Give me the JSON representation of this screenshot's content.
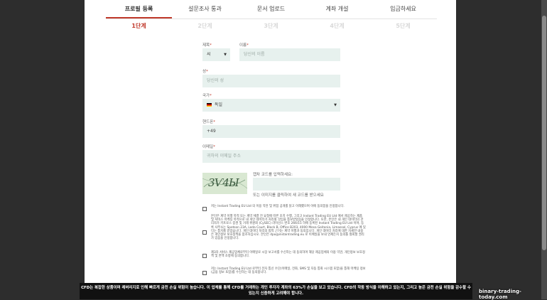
{
  "tabs": [
    "프로필 등록",
    "설문조사 통과",
    "문서 업로드",
    "계좌 개설",
    "입금하세요"
  ],
  "steps": [
    "1단계",
    "2단계",
    "3단계",
    "4단계",
    "5단계"
  ],
  "form": {
    "title_label": "제목",
    "title_value": "씨",
    "first_name_label": "이름",
    "first_name_placeholder": "당신의 이름",
    "last_name_label": "성",
    "last_name_placeholder": "당신의 성",
    "country_label": "국가",
    "country_value": "독일",
    "phone_label": "핸드폰",
    "phone_value": "+49",
    "email_label": "이메일",
    "email_placeholder": "귀하의 이메일 주소",
    "required_mark": "*"
  },
  "captcha": {
    "image_text": "3Ѵ4Ы",
    "prompt": "캡차 코드를 입력하세요:",
    "refresh_hint": "또는 이미지를 클릭하여 새 코드를 받으세요"
  },
  "checkboxes": [
    {
      "text": "저는 Instant Trading EU Ltd 의 이용 약관 및 위험 공개를 읽고 이해했으며 이에 동의함을 인정합니다."
    },
    {
      "text": "본인은 계약 이행 목적 또는 계약 체결 전 요청에 따른 조치 수행, 그리고 Instant Trading EU Ltd 에서 제공하는 제품 및 서비스 마케팅 목적으로 내 개인 데이터가 처리될 것임을 통보받았음을 인정합니다. 또한, 본인은 내 개인 데이터의 관리자가 키프로스 증권 및 거래 위원회 (CySEC) 라이선스 번호 266/15 하에 등록된 Instant Trading EU Ltd 이며, 등록 사무소는 Spetson 23A, Leda Court, Block B, Office B203, 4000 Mesa Geitonia, Limassol, Cyprus 에 있다는 통지를 받았습니다. 개인 데이터 처리의 법적 근거는 계약 이행과 동의입니다. 개인 데이터 처리에 대한 자세한 내용은 개인정보 보호정책을 참조하십시오. 본인은 dpo@instantrading.eu 로 이메일을 보내 언제든지 동의를 철회할 권리가 있음을 인정합니다."
    },
    {
      "text": "제3자 서비스 제공업체로부터 이메일로 시장 보고서를 수신하는 데 동의하며 해당 제공업체의 이용 약관, 개인정보 보호정책 및 면책 조항에 동의합니다."
    },
    {
      "text": "저는 Instant Trading EU Ltd 로부터 전자 통신 수단(이메일, 전화, SMS 및 자동 통화 시스템 포함)을 통해 마케팅 정보(금융 정보 포함)를 수신하는 데 동의합니다."
    }
  ],
  "risk_banner": "CFD는 복잡한 상품이며 레버리지로 인해 빠르게 금전 손실 위험이 높습니다. 이 업체를 통해 CFD를 거래하는 개인 투자자 계좌의 63%가 손실을 보고 있습니다. CFD의 작동 방식을 이해하고 있는지, 그리고 높은 금전 손실 위험을 감수할 수 있는지 신중하게 고려해야 합니다.",
  "watermark": "binary-trading-today.com"
}
